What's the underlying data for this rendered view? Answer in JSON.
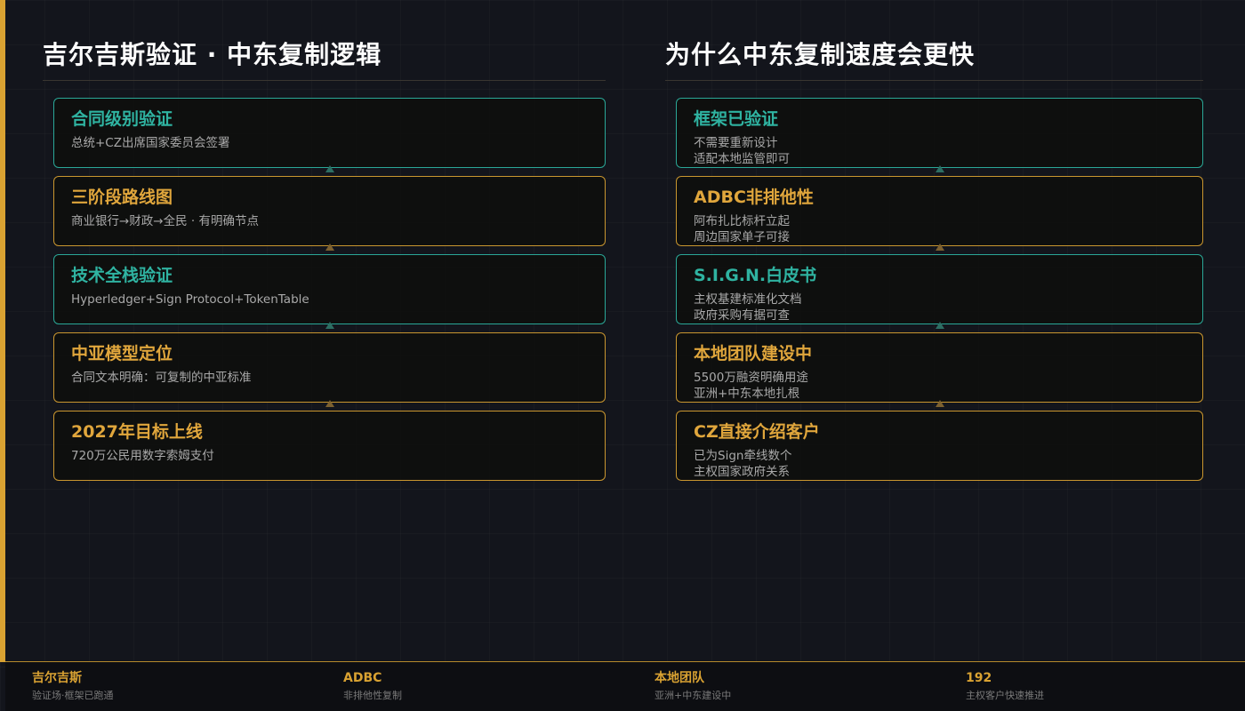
{
  "left": {
    "title": "吉尔吉斯验证 · 中东复制逻辑",
    "cards": [
      {
        "title": "合同级别验证",
        "lines": [
          "总统+CZ出席国家委员会签署"
        ],
        "accent": "#2fb3a1"
      },
      {
        "title": "三阶段路线图",
        "lines": [
          "商业银行→财政→全民 · 有明确节点"
        ],
        "accent": "#e0a63c"
      },
      {
        "title": "技术全栈验证",
        "lines": [
          "Hyperledger+Sign Protocol+TokenTable"
        ],
        "accent": "#2fb3a1"
      },
      {
        "title": "中亚模型定位",
        "lines": [
          "合同文本明确：可复制的中亚标准"
        ],
        "accent": "#e0a63c"
      },
      {
        "title": "2027年目标上线",
        "lines": [
          "720万公民用数字索姆支付"
        ],
        "accent": "#e0a63c"
      }
    ]
  },
  "right": {
    "title": "为什么中东复制速度会更快",
    "cards": [
      {
        "title": "框架已验证",
        "lines": [
          "不需要重新设计",
          "适配本地监管即可"
        ],
        "accent": "#2fb3a1"
      },
      {
        "title": "ADBC非排他性",
        "lines": [
          "阿布扎比标杆立起",
          "周边国家单子可接"
        ],
        "accent": "#e0a63c"
      },
      {
        "title": "S.I.G.N.白皮书",
        "lines": [
          "主权基建标准化文档",
          "政府采购有据可查"
        ],
        "accent": "#2fb3a1"
      },
      {
        "title": "本地团队建设中",
        "lines": [
          "5500万融资明确用途",
          "亚洲+中东本地扎根"
        ],
        "accent": "#e0a63c"
      },
      {
        "title": "CZ直接介绍客户",
        "lines": [
          "已为Sign牵线数个",
          "主权国家政府关系"
        ],
        "accent": "#e0a63c"
      }
    ]
  },
  "footer": {
    "stats": [
      {
        "value": "吉尔吉斯",
        "label": "验证场·框架已跑通"
      },
      {
        "value": "ADBC",
        "label": "非排他性复制"
      },
      {
        "value": "本地团队",
        "label": "亚洲+中东建设中"
      },
      {
        "value": "192",
        "label": "主权客户快速推进"
      }
    ]
  },
  "colors": {
    "teal": "#2fb3a1",
    "gold": "#d9a232",
    "background": "#13151c"
  }
}
